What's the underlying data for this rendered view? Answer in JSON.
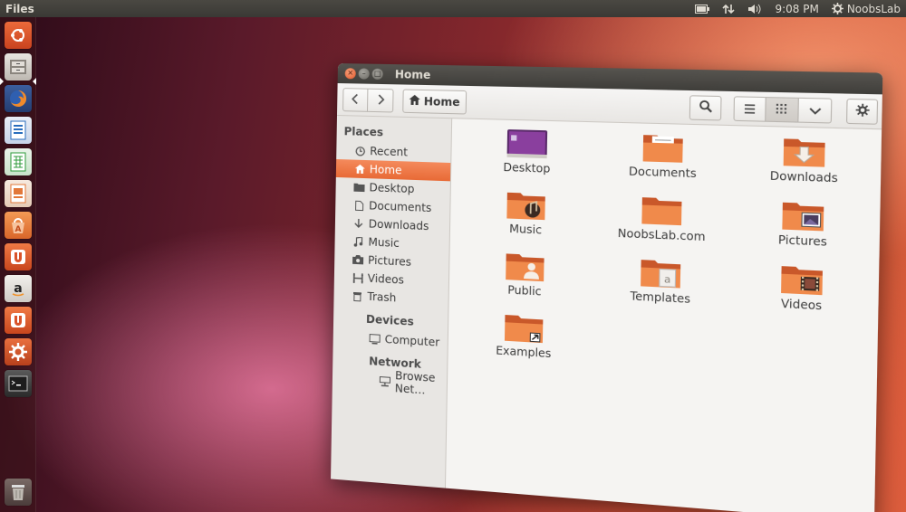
{
  "top_panel": {
    "app_title": "Files",
    "time": "9:08 PM",
    "user": "NoobsLab",
    "icons": [
      "battery-icon",
      "network-icon",
      "volume-icon",
      "session-gear-icon"
    ]
  },
  "launcher": {
    "items": [
      {
        "name": "dash-home",
        "icon": "ubuntu-logo-icon",
        "color": "#e05a2b"
      },
      {
        "name": "files",
        "icon": "file-cabinet-icon",
        "color": "#d9d5cf"
      },
      {
        "name": "firefox",
        "icon": "firefox-icon",
        "color": "#e8742a"
      },
      {
        "name": "writer",
        "icon": "libreoffice-writer-icon",
        "color": "#2a6ebd"
      },
      {
        "name": "calc",
        "icon": "libreoffice-calc-icon",
        "color": "#2c9a3a"
      },
      {
        "name": "impress",
        "icon": "libreoffice-impress-icon",
        "color": "#e2783a"
      },
      {
        "name": "software-center",
        "icon": "software-center-icon",
        "color": "#e2783a"
      },
      {
        "name": "ubuntu-one",
        "icon": "ubuntu-one-icon",
        "color": "#e2602a"
      },
      {
        "name": "amazon",
        "icon": "amazon-icon",
        "color": "#e9e6e1"
      },
      {
        "name": "ubuntu-one-music",
        "icon": "ubuntu-one-music-icon",
        "color": "#e2602a"
      },
      {
        "name": "settings",
        "icon": "system-settings-icon",
        "color": "#d45a2a"
      },
      {
        "name": "terminal",
        "icon": "terminal-icon",
        "color": "#3a3a3a"
      },
      {
        "name": "trash",
        "icon": "trash-icon",
        "color": "#6a6a6a"
      }
    ]
  },
  "window": {
    "title": "Home",
    "toolbar": {
      "breadcrumb": "Home"
    },
    "sidebar": {
      "places_header": "Places",
      "places": [
        {
          "label": "Recent",
          "icon": "clock-icon"
        },
        {
          "label": "Home",
          "icon": "home-icon",
          "selected": true
        },
        {
          "label": "Desktop",
          "icon": "desktop-folder-icon"
        },
        {
          "label": "Documents",
          "icon": "document-icon"
        },
        {
          "label": "Downloads",
          "icon": "download-arrow-icon"
        },
        {
          "label": "Music",
          "icon": "music-note-icon"
        },
        {
          "label": "Pictures",
          "icon": "camera-icon"
        },
        {
          "label": "Videos",
          "icon": "film-icon"
        },
        {
          "label": "Trash",
          "icon": "trash-icon"
        }
      ],
      "devices_header": "Devices",
      "devices": [
        {
          "label": "Computer",
          "icon": "computer-icon"
        }
      ],
      "network_header": "Network",
      "network": [
        {
          "label": "Browse Net…",
          "icon": "network-icon"
        }
      ]
    },
    "files": [
      {
        "label": "Desktop",
        "icon": "desktop-folder-icon",
        "emblem": "desktop"
      },
      {
        "label": "Documents",
        "icon": "documents-folder-icon",
        "emblem": "documents"
      },
      {
        "label": "Downloads",
        "icon": "downloads-folder-icon",
        "emblem": "downloads"
      },
      {
        "label": "Music",
        "icon": "music-folder-icon",
        "emblem": "music"
      },
      {
        "label": "NoobsLab.com",
        "icon": "folder-icon",
        "emblem": "none"
      },
      {
        "label": "Pictures",
        "icon": "pictures-folder-icon",
        "emblem": "pictures"
      },
      {
        "label": "Public",
        "icon": "public-folder-icon",
        "emblem": "public"
      },
      {
        "label": "Templates",
        "icon": "templates-folder-icon",
        "emblem": "templates"
      },
      {
        "label": "Videos",
        "icon": "videos-folder-icon",
        "emblem": "videos"
      },
      {
        "label": "Examples",
        "icon": "examples-folder-icon",
        "emblem": "examples"
      }
    ]
  },
  "colors": {
    "accent": "#e86a36",
    "folder": "#f08a4b",
    "panel": "#3f3e3a"
  }
}
